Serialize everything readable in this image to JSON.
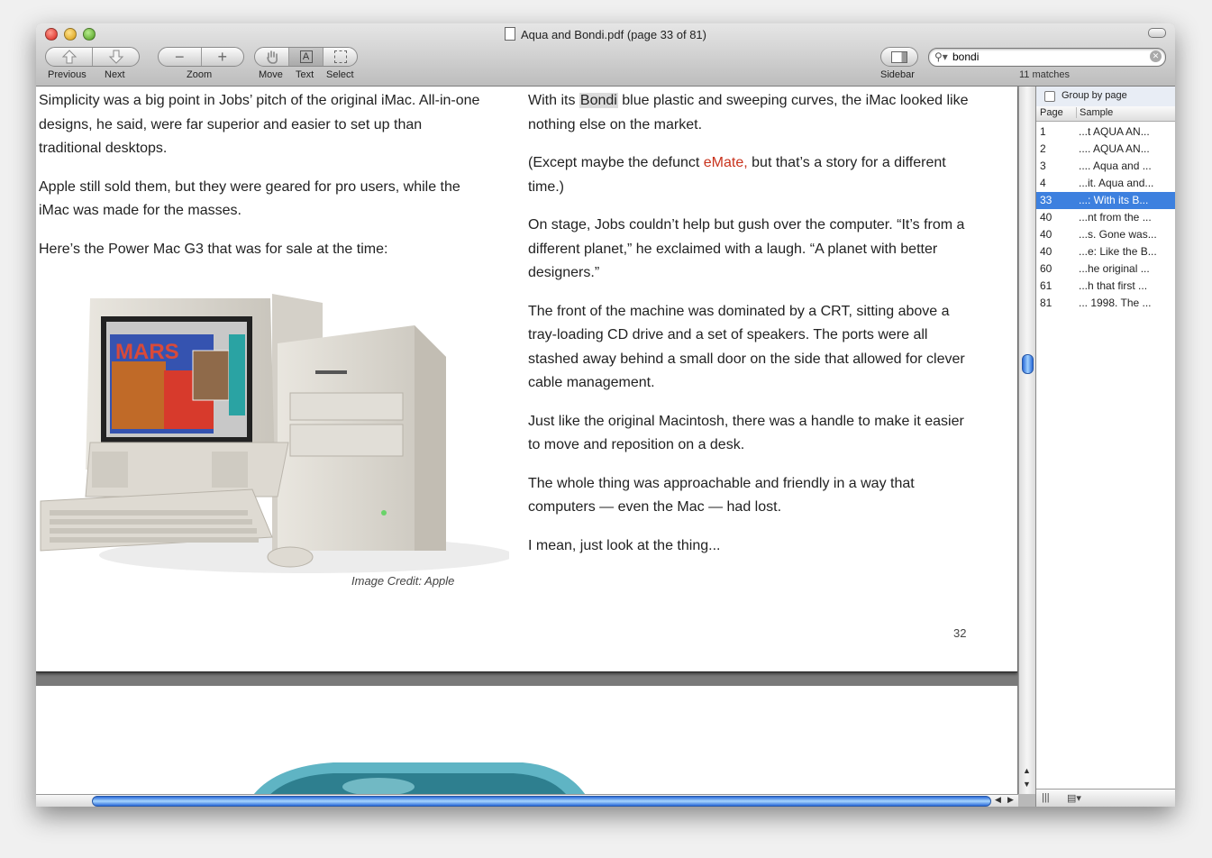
{
  "window": {
    "title": "Aqua and Bondi.pdf (page 33 of 81)"
  },
  "toolbar": {
    "previous_label": "Previous",
    "next_label": "Next",
    "zoom_label": "Zoom",
    "move_label": "Move",
    "text_label": "Text",
    "select_label": "Select",
    "sidebar_label": "Sidebar",
    "zoom_out_glyph": "−",
    "zoom_in_glyph": "+",
    "text_tool_glyph": "A"
  },
  "search": {
    "value": "bondi",
    "matches": "11 matches"
  },
  "page": {
    "left_col": [
      "Simplicity was a big point in Jobs’ pitch of the original iMac. All-in-one designs, he said, were far superior and easier to set up than traditional desktops.",
      "Apple still sold them, but they were geared for pro users, while the iMac was made for the masses.",
      "Here’s the Power Mac G3 that was for sale at the time:"
    ],
    "right_col": {
      "p1_before": "With its ",
      "p1_hl": "Bondi",
      "p1_after": " blue plastic and sweeping curves, the iMac looked like nothing else on the market.",
      "p2_before": "(Except maybe the defunct ",
      "p2_link": "eMate,",
      "p2_after": " but that’s a story for a different time.)",
      "p3": "On stage, Jobs couldn’t help but gush over the computer. “It’s from a different planet,” he exclaimed with a laugh. “A planet with better designers.”",
      "p4": "The front of the machine was dominated by a CRT, sitting above a tray-loading CD drive and a set of speakers. The ports were all stashed away behind a small door on the side that allowed for clever cable management.",
      "p5": "Just like the original Macintosh, there was a handle to make it easier to move and reposition on a desk.",
      "p6": "The whole thing was approachable and friendly in a way that computers — even the Mac — had lost.",
      "p7": "I mean, just look at the thing..."
    },
    "caption": "Image Credit: Apple",
    "page_number": "32",
    "screen_text": "MARS"
  },
  "sidebar": {
    "group_by_label": "Group by page",
    "col_page": "Page",
    "col_sample": "Sample",
    "results": [
      {
        "page": "1",
        "sample": "...t  AQUA AN..."
      },
      {
        "page": "2",
        "sample": "....  AQUA AN..."
      },
      {
        "page": "3",
        "sample": "....  Aqua and ..."
      },
      {
        "page": "4",
        "sample": "...it. Aqua and..."
      },
      {
        "page": "33",
        "sample": "...:  With its B..."
      },
      {
        "page": "40",
        "sample": "...nt from the ..."
      },
      {
        "page": "40",
        "sample": "...s. Gone was..."
      },
      {
        "page": "40",
        "sample": "...e: Like the B..."
      },
      {
        "page": "60",
        "sample": "...he original ..."
      },
      {
        "page": "61",
        "sample": "...h that first ..."
      },
      {
        "page": "81",
        "sample": "... 1998.  The ..."
      }
    ],
    "selected_index": 4
  }
}
